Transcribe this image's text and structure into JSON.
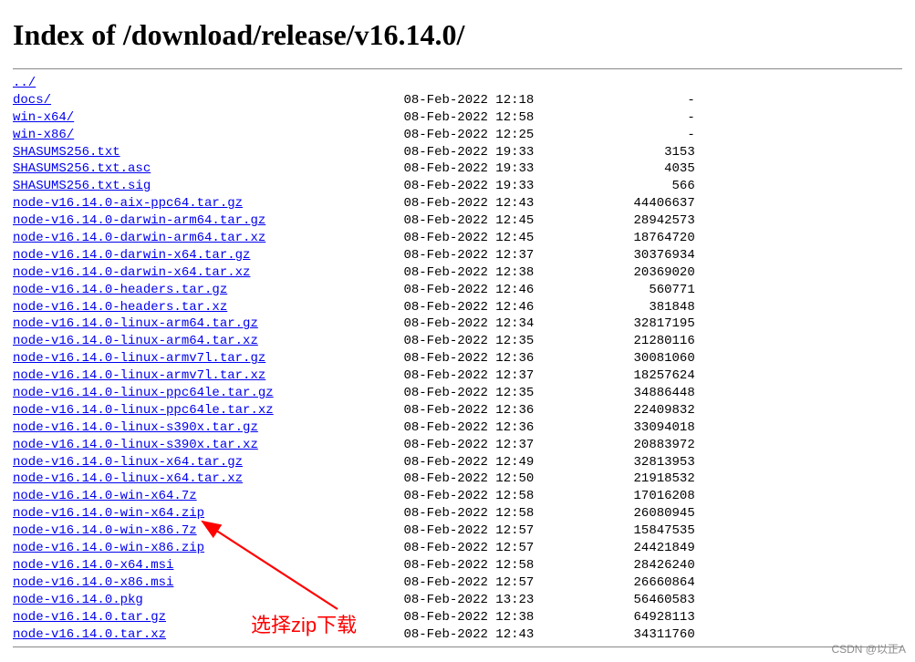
{
  "title": "Index of /download/release/v16.14.0/",
  "parent": "../",
  "name_col_width": 51,
  "date_col_width": 19,
  "size_col_width": 19,
  "files": [
    {
      "name": "docs/",
      "date": "08-Feb-2022 12:18",
      "size": "-"
    },
    {
      "name": "win-x64/",
      "date": "08-Feb-2022 12:58",
      "size": "-"
    },
    {
      "name": "win-x86/",
      "date": "08-Feb-2022 12:25",
      "size": "-"
    },
    {
      "name": "SHASUMS256.txt",
      "date": "08-Feb-2022 19:33",
      "size": "3153"
    },
    {
      "name": "SHASUMS256.txt.asc",
      "date": "08-Feb-2022 19:33",
      "size": "4035"
    },
    {
      "name": "SHASUMS256.txt.sig",
      "date": "08-Feb-2022 19:33",
      "size": "566"
    },
    {
      "name": "node-v16.14.0-aix-ppc64.tar.gz",
      "date": "08-Feb-2022 12:43",
      "size": "44406637"
    },
    {
      "name": "node-v16.14.0-darwin-arm64.tar.gz",
      "date": "08-Feb-2022 12:45",
      "size": "28942573"
    },
    {
      "name": "node-v16.14.0-darwin-arm64.tar.xz",
      "date": "08-Feb-2022 12:45",
      "size": "18764720"
    },
    {
      "name": "node-v16.14.0-darwin-x64.tar.gz",
      "date": "08-Feb-2022 12:37",
      "size": "30376934"
    },
    {
      "name": "node-v16.14.0-darwin-x64.tar.xz",
      "date": "08-Feb-2022 12:38",
      "size": "20369020"
    },
    {
      "name": "node-v16.14.0-headers.tar.gz",
      "date": "08-Feb-2022 12:46",
      "size": "560771"
    },
    {
      "name": "node-v16.14.0-headers.tar.xz",
      "date": "08-Feb-2022 12:46",
      "size": "381848"
    },
    {
      "name": "node-v16.14.0-linux-arm64.tar.gz",
      "date": "08-Feb-2022 12:34",
      "size": "32817195"
    },
    {
      "name": "node-v16.14.0-linux-arm64.tar.xz",
      "date": "08-Feb-2022 12:35",
      "size": "21280116"
    },
    {
      "name": "node-v16.14.0-linux-armv7l.tar.gz",
      "date": "08-Feb-2022 12:36",
      "size": "30081060"
    },
    {
      "name": "node-v16.14.0-linux-armv7l.tar.xz",
      "date": "08-Feb-2022 12:37",
      "size": "18257624"
    },
    {
      "name": "node-v16.14.0-linux-ppc64le.tar.gz",
      "date": "08-Feb-2022 12:35",
      "size": "34886448"
    },
    {
      "name": "node-v16.14.0-linux-ppc64le.tar.xz",
      "date": "08-Feb-2022 12:36",
      "size": "22409832"
    },
    {
      "name": "node-v16.14.0-linux-s390x.tar.gz",
      "date": "08-Feb-2022 12:36",
      "size": "33094018"
    },
    {
      "name": "node-v16.14.0-linux-s390x.tar.xz",
      "date": "08-Feb-2022 12:37",
      "size": "20883972"
    },
    {
      "name": "node-v16.14.0-linux-x64.tar.gz",
      "date": "08-Feb-2022 12:49",
      "size": "32813953"
    },
    {
      "name": "node-v16.14.0-linux-x64.tar.xz",
      "date": "08-Feb-2022 12:50",
      "size": "21918532"
    },
    {
      "name": "node-v16.14.0-win-x64.7z",
      "date": "08-Feb-2022 12:58",
      "size": "17016208"
    },
    {
      "name": "node-v16.14.0-win-x64.zip",
      "date": "08-Feb-2022 12:58",
      "size": "26080945"
    },
    {
      "name": "node-v16.14.0-win-x86.7z",
      "date": "08-Feb-2022 12:57",
      "size": "15847535"
    },
    {
      "name": "node-v16.14.0-win-x86.zip",
      "date": "08-Feb-2022 12:57",
      "size": "24421849"
    },
    {
      "name": "node-v16.14.0-x64.msi",
      "date": "08-Feb-2022 12:58",
      "size": "28426240"
    },
    {
      "name": "node-v16.14.0-x86.msi",
      "date": "08-Feb-2022 12:57",
      "size": "26660864"
    },
    {
      "name": "node-v16.14.0.pkg",
      "date": "08-Feb-2022 13:23",
      "size": "56460583"
    },
    {
      "name": "node-v16.14.0.tar.gz",
      "date": "08-Feb-2022 12:38",
      "size": "64928113"
    },
    {
      "name": "node-v16.14.0.tar.xz",
      "date": "08-Feb-2022 12:43",
      "size": "34311760"
    }
  ],
  "annotation_text": "选择zip下载",
  "watermark": "CSDN @以正A"
}
